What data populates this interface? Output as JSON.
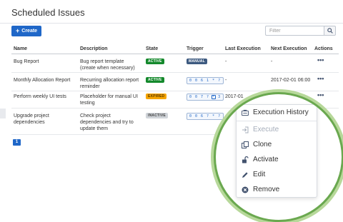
{
  "page": {
    "title": "Scheduled Issues"
  },
  "toolbar": {
    "create_label": "Create",
    "filter_placeholder": "Filter"
  },
  "table": {
    "headers": {
      "name": "Name",
      "description": "Description",
      "state": "State",
      "trigger": "Trigger",
      "last_execution": "Last Execution",
      "next_execution": "Next Execution",
      "actions": "Actions"
    },
    "rows": [
      {
        "name": "Bug Report",
        "description": [
          "Bug report template",
          "(create when necessary)"
        ],
        "state": "ACTIVE",
        "trigger": "MANUAL",
        "last_execution": "-",
        "next_execution": "-"
      },
      {
        "name": "Monthly Allocation Report",
        "description": [
          "Recurring allocation report",
          "reminder"
        ],
        "state": "ACTIVE",
        "trigger": "0 0 6 1 * ?",
        "last_execution": "-",
        "next_execution": "2017-02-01 06:00"
      },
      {
        "name": "Perform weekly UI tests",
        "description": [
          "Placeholder for manual UI",
          "testing"
        ],
        "state": "EXPIRED",
        "trigger": "0 0 7 ? * 3",
        "last_execution": "2017-01",
        "next_execution": ""
      },
      {
        "name": [
          "Upgrade project",
          "dependencies"
        ],
        "description": [
          "Check project",
          "dependencies and try to",
          "update them"
        ],
        "state": "INACTIVE",
        "trigger": "0 0 6 ? * ?",
        "last_execution": "",
        "next_execution": ""
      }
    ]
  },
  "pagination": {
    "current_page": "1"
  },
  "action_menu": {
    "items": [
      {
        "label": "Execution History",
        "icon": "execution-history-icon",
        "enabled": true
      },
      {
        "label": "Execute",
        "icon": "execute-icon",
        "enabled": false
      },
      {
        "label": "Clone",
        "icon": "clone-icon",
        "enabled": true
      },
      {
        "label": "Activate",
        "icon": "unlock-icon",
        "enabled": true
      },
      {
        "label": "Edit",
        "icon": "pencil-icon",
        "enabled": true
      },
      {
        "label": "Remove",
        "icon": "remove-icon",
        "enabled": true
      }
    ]
  },
  "colors": {
    "primary": "#1f67c8",
    "active": "#14892c",
    "expired": "#f6a500",
    "inactive": "#d0d4d9",
    "manual": "#3d5a80",
    "lens_border": "#6aa84f"
  }
}
